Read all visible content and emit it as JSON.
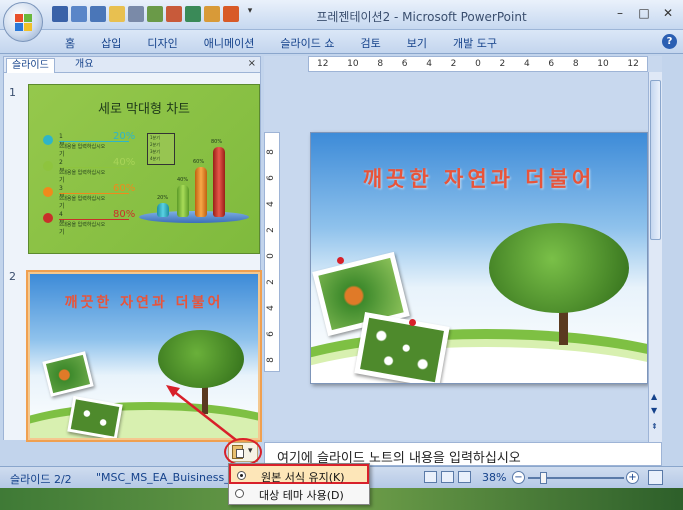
{
  "window": {
    "title": "프레젠테이션2 - Microsoft PowerPoint",
    "minimize": "–",
    "maximize": "□",
    "close": "✕"
  },
  "ribbon": {
    "tabs": [
      "홈",
      "삽입",
      "디자인",
      "애니메이션",
      "슬라이드 쇼",
      "검토",
      "보기",
      "개발 도구"
    ],
    "help": "?"
  },
  "left_panel": {
    "tab_slides": "슬라이드",
    "tab_outline": "개요",
    "close": "×",
    "slide1_number": "1",
    "slide2_number": "2"
  },
  "thumb1": {
    "title": "세로 막대형 차트",
    "legend": [
      {
        "name": "1분기",
        "sub": ": 내용을 입력하십시오",
        "pct": "20%",
        "color": "#2fb5c8"
      },
      {
        "name": "2분기",
        "sub": ": 내용을 입력하십시오",
        "pct": "40%",
        "color": "#8ec43e"
      },
      {
        "name": "3분기",
        "sub": ": 내용을 입력하십시오",
        "pct": "60%",
        "color": "#f08a1c"
      },
      {
        "name": "4분기",
        "sub": ": 내용을 입력하십시오",
        "pct": "80%",
        "color": "#c8302a"
      }
    ],
    "mini_legend": [
      "1분기",
      "2분기",
      "3분기",
      "4분기"
    ],
    "bar_labels": [
      "20%",
      "40%",
      "60%",
      "80%"
    ]
  },
  "thumb2": {
    "title": "깨끗한 자연과 더불어"
  },
  "slide": {
    "title": "깨끗한 자연과 더불어"
  },
  "ruler": {
    "h_ticks": [
      "12",
      "10",
      "8",
      "6",
      "4",
      "2",
      "0",
      "2",
      "4",
      "6",
      "8",
      "10",
      "12"
    ],
    "v_ticks": [
      "8",
      "6",
      "4",
      "2",
      "0",
      "2",
      "4",
      "6",
      "8"
    ]
  },
  "notes": {
    "text": "여기에 슬라이드 노트의 내용을 입력하십시오"
  },
  "paste_menu": {
    "keep_source": "원본 서식 유지(K)",
    "use_theme": "대상 테마 사용(D)"
  },
  "status": {
    "slide_count": "슬라이드 2/2",
    "theme": "\"MSC_MS_EA_Buisiness_ID",
    "zoom": "38%",
    "minus": "−",
    "plus": "+"
  }
}
